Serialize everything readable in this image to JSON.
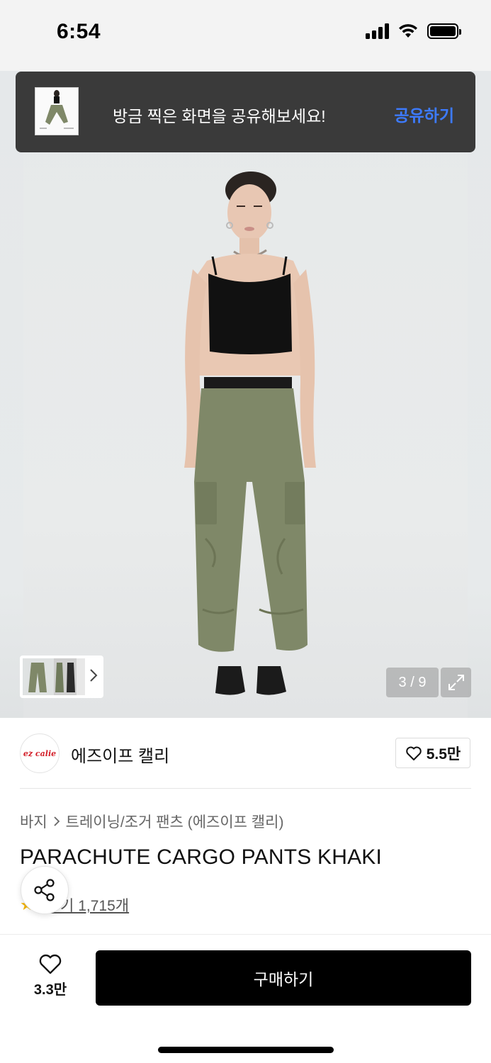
{
  "status_bar": {
    "time": "6:54"
  },
  "toast": {
    "message": "방금 찍은 화면을 공유해보세요!",
    "action": "공유하기"
  },
  "gallery": {
    "counter": "3 / 9"
  },
  "brand": {
    "logo_text": "ez calie",
    "name": "에즈이프 캘리",
    "likes": "5.5만"
  },
  "breadcrumb": {
    "category": "바지",
    "subcategory": "트레이닝/조거 팬츠 (에즈이프 캘리)"
  },
  "product": {
    "title": "PARACHUTE CARGO PANTS KHAKI",
    "review_link": "후기 1,715개"
  },
  "bottom_bar": {
    "wish_count": "3.3만",
    "buy_label": "구매하기"
  },
  "colors": {
    "accent_blue": "#3d7bff",
    "toast_bg": "#3a3a3a",
    "buy_bg": "#000000",
    "star": "#f5b400"
  }
}
